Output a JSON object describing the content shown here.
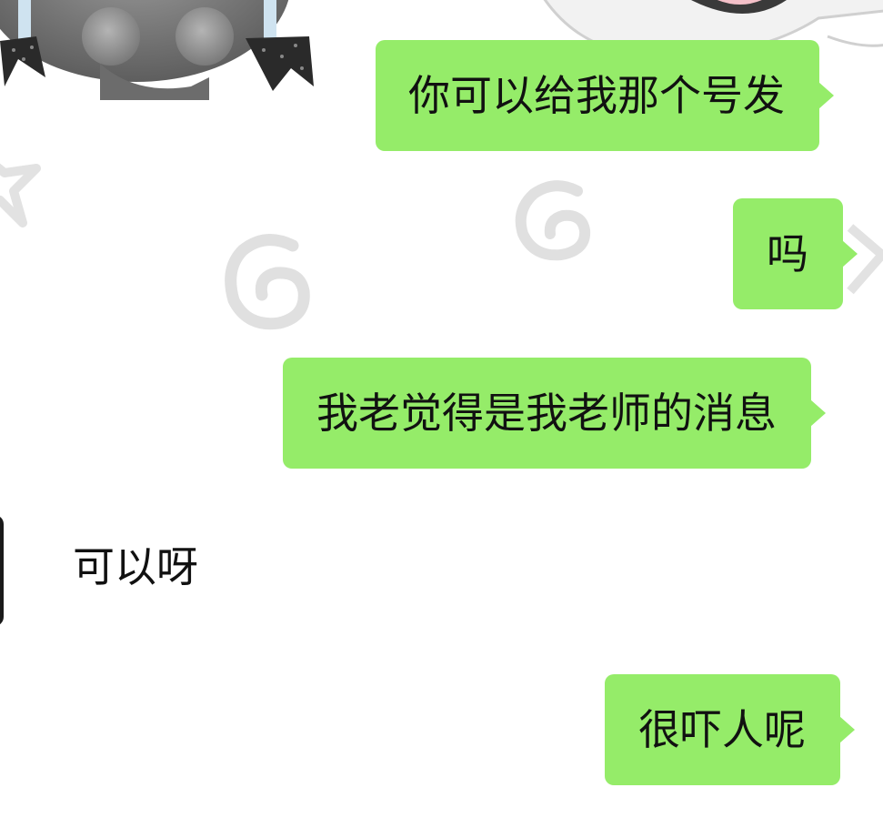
{
  "chat": {
    "messages": [
      {
        "direction": "outgoing",
        "text": "你可以给我那个号发"
      },
      {
        "direction": "outgoing",
        "text": "吗"
      },
      {
        "direction": "outgoing",
        "text": "我老觉得是我老师的消息"
      },
      {
        "direction": "incoming",
        "text": "可以呀"
      },
      {
        "direction": "outgoing",
        "text": "很吓人呢"
      }
    ]
  },
  "colors": {
    "outgoing_bubble": "#95ec69",
    "background": "#ffffff",
    "text": "#111111"
  },
  "icons": {
    "wallpaper": [
      "cartoon-character-icon",
      "swirl-icon",
      "star-icon"
    ]
  }
}
